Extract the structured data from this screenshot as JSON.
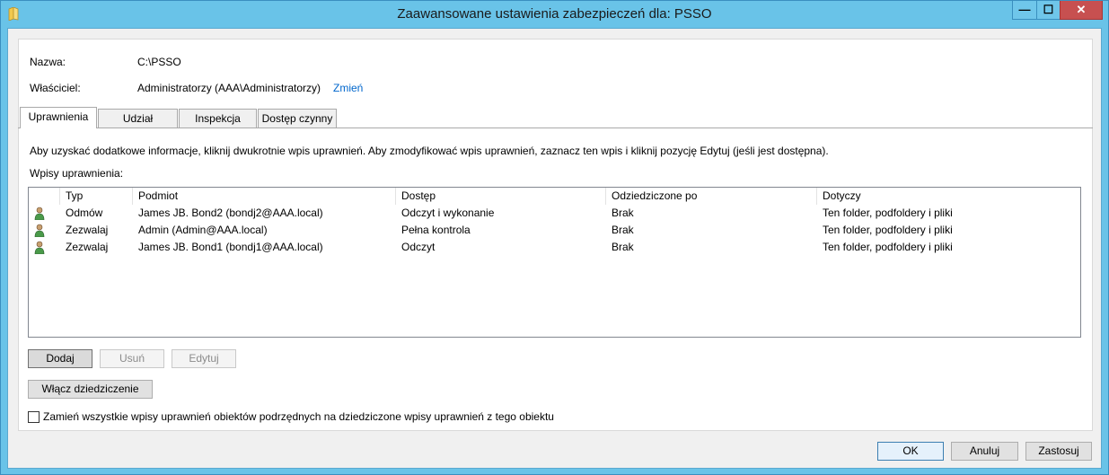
{
  "window": {
    "title": "Zaawansowane ustawienia zabezpieczeń dla: PSSO",
    "min_glyph": "—",
    "max_glyph": "☐",
    "close_glyph": "✕"
  },
  "info": {
    "name_label": "Nazwa:",
    "name_value": "C:\\PSSO",
    "owner_label": "Właściciel:",
    "owner_value": "Administratorzy (AAA\\Administratorzy)",
    "owner_change": "Zmień"
  },
  "tabs": [
    {
      "label": "Uprawnienia",
      "active": true
    },
    {
      "label": "Udział"
    },
    {
      "label": "Inspekcja"
    },
    {
      "label": "Dostęp czynny"
    }
  ],
  "permissions": {
    "instructions": "Aby uzyskać dodatkowe informacje, kliknij dwukrotnie wpis uprawnień. Aby zmodyfikować wpis uprawnień, zaznacz ten wpis i kliknij pozycję Edytuj (jeśli jest dostępna).",
    "entries_label": "Wpisy uprawnienia:",
    "columns": [
      "Typ",
      "Podmiot",
      "Dostęp",
      "Odziedziczone po",
      "Dotyczy"
    ],
    "rows": [
      {
        "icon": "user-icon",
        "type": "Odmów",
        "principal": "James JB. Bond2 (bondj2@AAA.local)",
        "access": "Odczyt i wykonanie",
        "inherited": "Brak",
        "applies": "Ten folder, podfoldery i pliki"
      },
      {
        "icon": "user-icon",
        "type": "Zezwalaj",
        "principal": "Admin (Admin@AAA.local)",
        "access": "Pełna kontrola",
        "inherited": "Brak",
        "applies": "Ten folder, podfoldery i pliki"
      },
      {
        "icon": "user-icon",
        "type": "Zezwalaj",
        "principal": "James JB. Bond1 (bondj1@AAA.local)",
        "access": "Odczyt",
        "inherited": "Brak",
        "applies": "Ten folder, podfoldery i pliki"
      }
    ]
  },
  "buttons": {
    "add": "Dodaj",
    "remove": "Usuń",
    "edit": "Edytuj",
    "enable_inheritance": "Włącz dziedziczenie",
    "replace_label": "Zamień wszystkie wpisy uprawnień obiektów podrzędnych na dziedziczone wpisy uprawnień z tego obiektu",
    "ok": "OK",
    "cancel": "Anuluj",
    "apply": "Zastosuj"
  },
  "colors": {
    "frame": "#69c3e8",
    "link": "#0066cc",
    "close_button": "#c75050"
  }
}
